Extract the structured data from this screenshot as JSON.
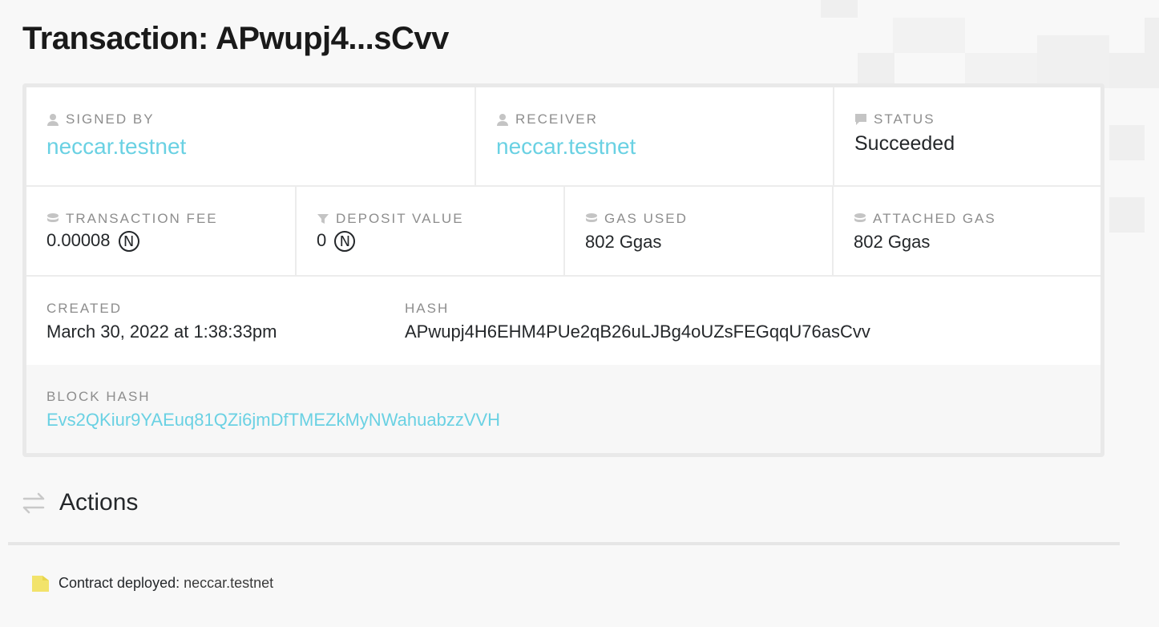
{
  "page": {
    "title": "Transaction: APwupj4...sCvv"
  },
  "summary": {
    "signed_by": {
      "label": "SIGNED BY",
      "value": "neccar.testnet",
      "icon": "user-icon"
    },
    "receiver": {
      "label": "RECEIVER",
      "value": "neccar.testnet",
      "icon": "user-icon"
    },
    "status": {
      "label": "STATUS",
      "value": "Succeeded",
      "icon": "comment-icon"
    },
    "transaction_fee": {
      "label": "TRANSACTION FEE",
      "value": "0.00008",
      "unit": "N",
      "icon": "coins-icon"
    },
    "deposit_value": {
      "label": "DEPOSIT VALUE",
      "value": "0",
      "unit": "N",
      "icon": "funnel-icon"
    },
    "gas_used": {
      "label": "GAS USED",
      "value": "802 Ggas",
      "icon": "coins-icon"
    },
    "attached_gas": {
      "label": "ATTACHED GAS",
      "value": "802 Ggas",
      "icon": "coins-icon"
    },
    "created": {
      "label": "CREATED",
      "value": "March 30, 2022 at 1:38:33pm"
    },
    "hash": {
      "label": "HASH",
      "value": "APwupj4H6EHM4PUe2qB26uLJBg4oUZsFEGqqU76asCvv"
    },
    "block_hash": {
      "label": "BLOCK HASH",
      "value": "Evs2QKiur9YAEuq81QZi6jmDfTMEZkMyNWahuabzzVVH"
    }
  },
  "actions": {
    "title": "Actions",
    "icon": "transfer-arrows-icon",
    "items": [
      {
        "text": "Contract deployed: ",
        "account": "neccar.testnet",
        "icon": "file-icon"
      }
    ]
  },
  "colors": {
    "link": "#6ad1e3",
    "label": "#8d8d8d",
    "file_icon": "#f2e36b"
  }
}
